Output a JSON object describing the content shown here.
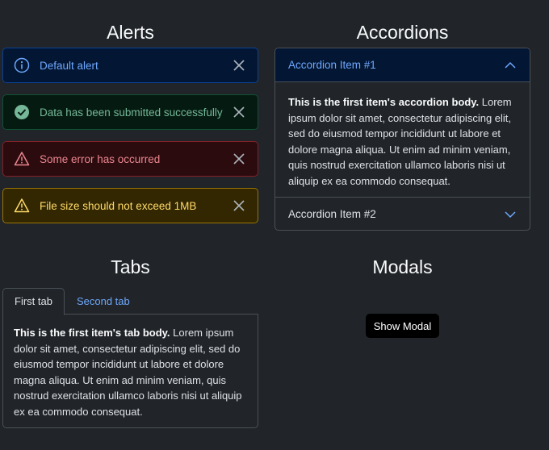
{
  "alerts_section": {
    "title": "Alerts",
    "items": [
      {
        "type": "info",
        "text": "Default alert"
      },
      {
        "type": "success",
        "text": "Data has been submitted successfully"
      },
      {
        "type": "danger",
        "text": "Some error has occurred"
      },
      {
        "type": "warning",
        "text": "File size should not exceed 1MB"
      }
    ]
  },
  "accordions_section": {
    "title": "Accordions",
    "items": [
      {
        "label": "Accordion Item #1",
        "expanded": true,
        "body_bold": "This is the first item's accordion body.",
        "body_text": " Lorem ipsum dolor sit amet, consectetur adipiscing elit, sed do eiusmod tempor incididunt ut labore et dolore magna aliqua. Ut enim ad minim veniam, quis nostrud exercitation ullamco laboris nisi ut aliquip ex ea commodo consequat."
      },
      {
        "label": "Accordion Item #2",
        "expanded": false
      }
    ]
  },
  "tabs_section": {
    "title": "Tabs",
    "tabs": [
      {
        "label": "First tab",
        "active": true
      },
      {
        "label": "Second tab",
        "active": false
      }
    ],
    "body_bold": "This is the first item's tab body.",
    "body_text": " Lorem ipsum dolor sit amet, consectetur adipiscing elit, sed do eiusmod tempor incididunt ut labore et dolore magna aliqua. Ut enim ad minim veniam, quis nostrud exercitation ullamco laboris nisi ut aliquip ex ea commodo consequat."
  },
  "modals_section": {
    "title": "Modals",
    "button_label": "Show Modal"
  },
  "colors": {
    "background": "#212529",
    "info": "#6ea8fe",
    "success": "#75b798",
    "danger": "#ea868f",
    "warning": "#ffda6a"
  }
}
